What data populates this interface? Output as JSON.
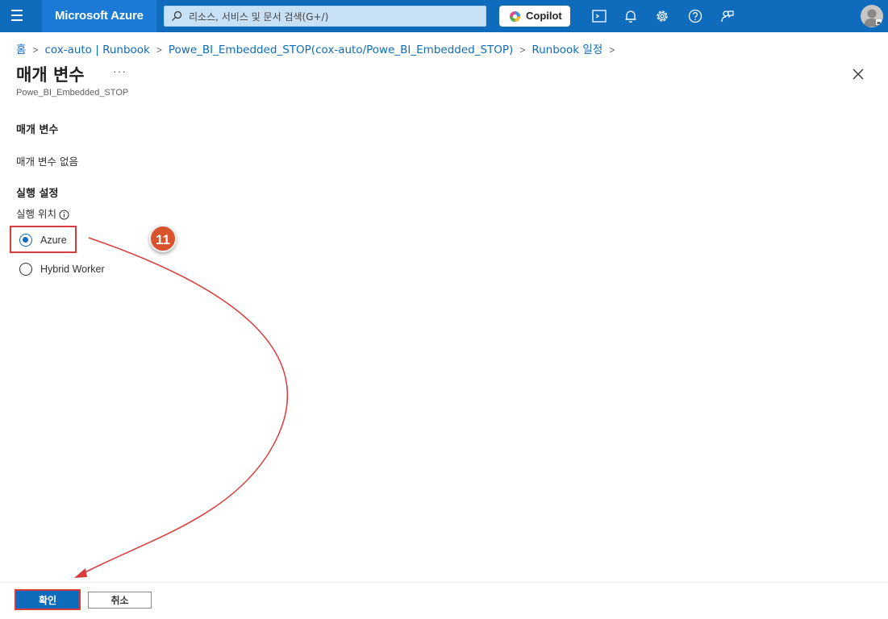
{
  "topbar": {
    "brand": "Microsoft Azure",
    "search_placeholder": "리소스, 서비스 및 문서 검색(G+/)",
    "copilot_label": "Copilot",
    "icons": [
      "menu-icon",
      "cloud-shell-icon",
      "notifications-icon",
      "settings-icon",
      "help-icon",
      "feedback-icon"
    ]
  },
  "breadcrumb": {
    "home": "홈",
    "items": [
      "cox-auto | Runbook",
      "Powe_BI_Embedded_STOP(cox-auto/Powe_BI_Embedded_STOP)",
      "Runbook 일정"
    ]
  },
  "page": {
    "title": "매개 변수",
    "more": "···",
    "subtitle": "Powe_BI_Embedded_STOP"
  },
  "params": {
    "heading": "매개 변수",
    "empty_text": "매개 변수 없음"
  },
  "run_settings": {
    "heading": "실행 설정",
    "location_label": "실행 위치",
    "options": [
      {
        "label": "Azure",
        "checked": true
      },
      {
        "label": "Hybrid Worker",
        "checked": false
      }
    ]
  },
  "annotation": {
    "step": "11",
    "color": "#d83b3b"
  },
  "footer": {
    "ok_label": "확인",
    "cancel_label": "취소"
  },
  "colors": {
    "accent": "#0f6cbd",
    "annotation_red": "#d83b3b",
    "badge": "#d9532c"
  }
}
